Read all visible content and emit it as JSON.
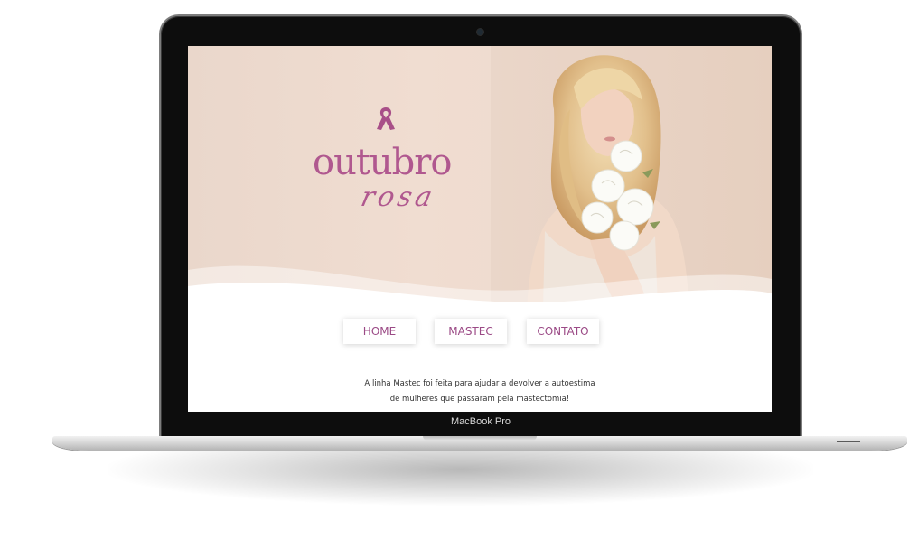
{
  "device": {
    "brand_label": "MacBook Pro"
  },
  "logo": {
    "word1": "outubro",
    "word2": "rosa",
    "ribbon_icon": "pink-ribbon-icon"
  },
  "nav": {
    "items": [
      "HOME",
      "MASTEC",
      "CONTATO"
    ]
  },
  "tagline": {
    "line1": "A linha Mastec foi feita para ajudar a devolver a autoestima",
    "line2": "de mulheres que passaram pela mastectomia!"
  },
  "colors": {
    "accent": "#b0588f",
    "hero_bg": "#ecd8cb",
    "nav_text": "#9b4a86"
  }
}
